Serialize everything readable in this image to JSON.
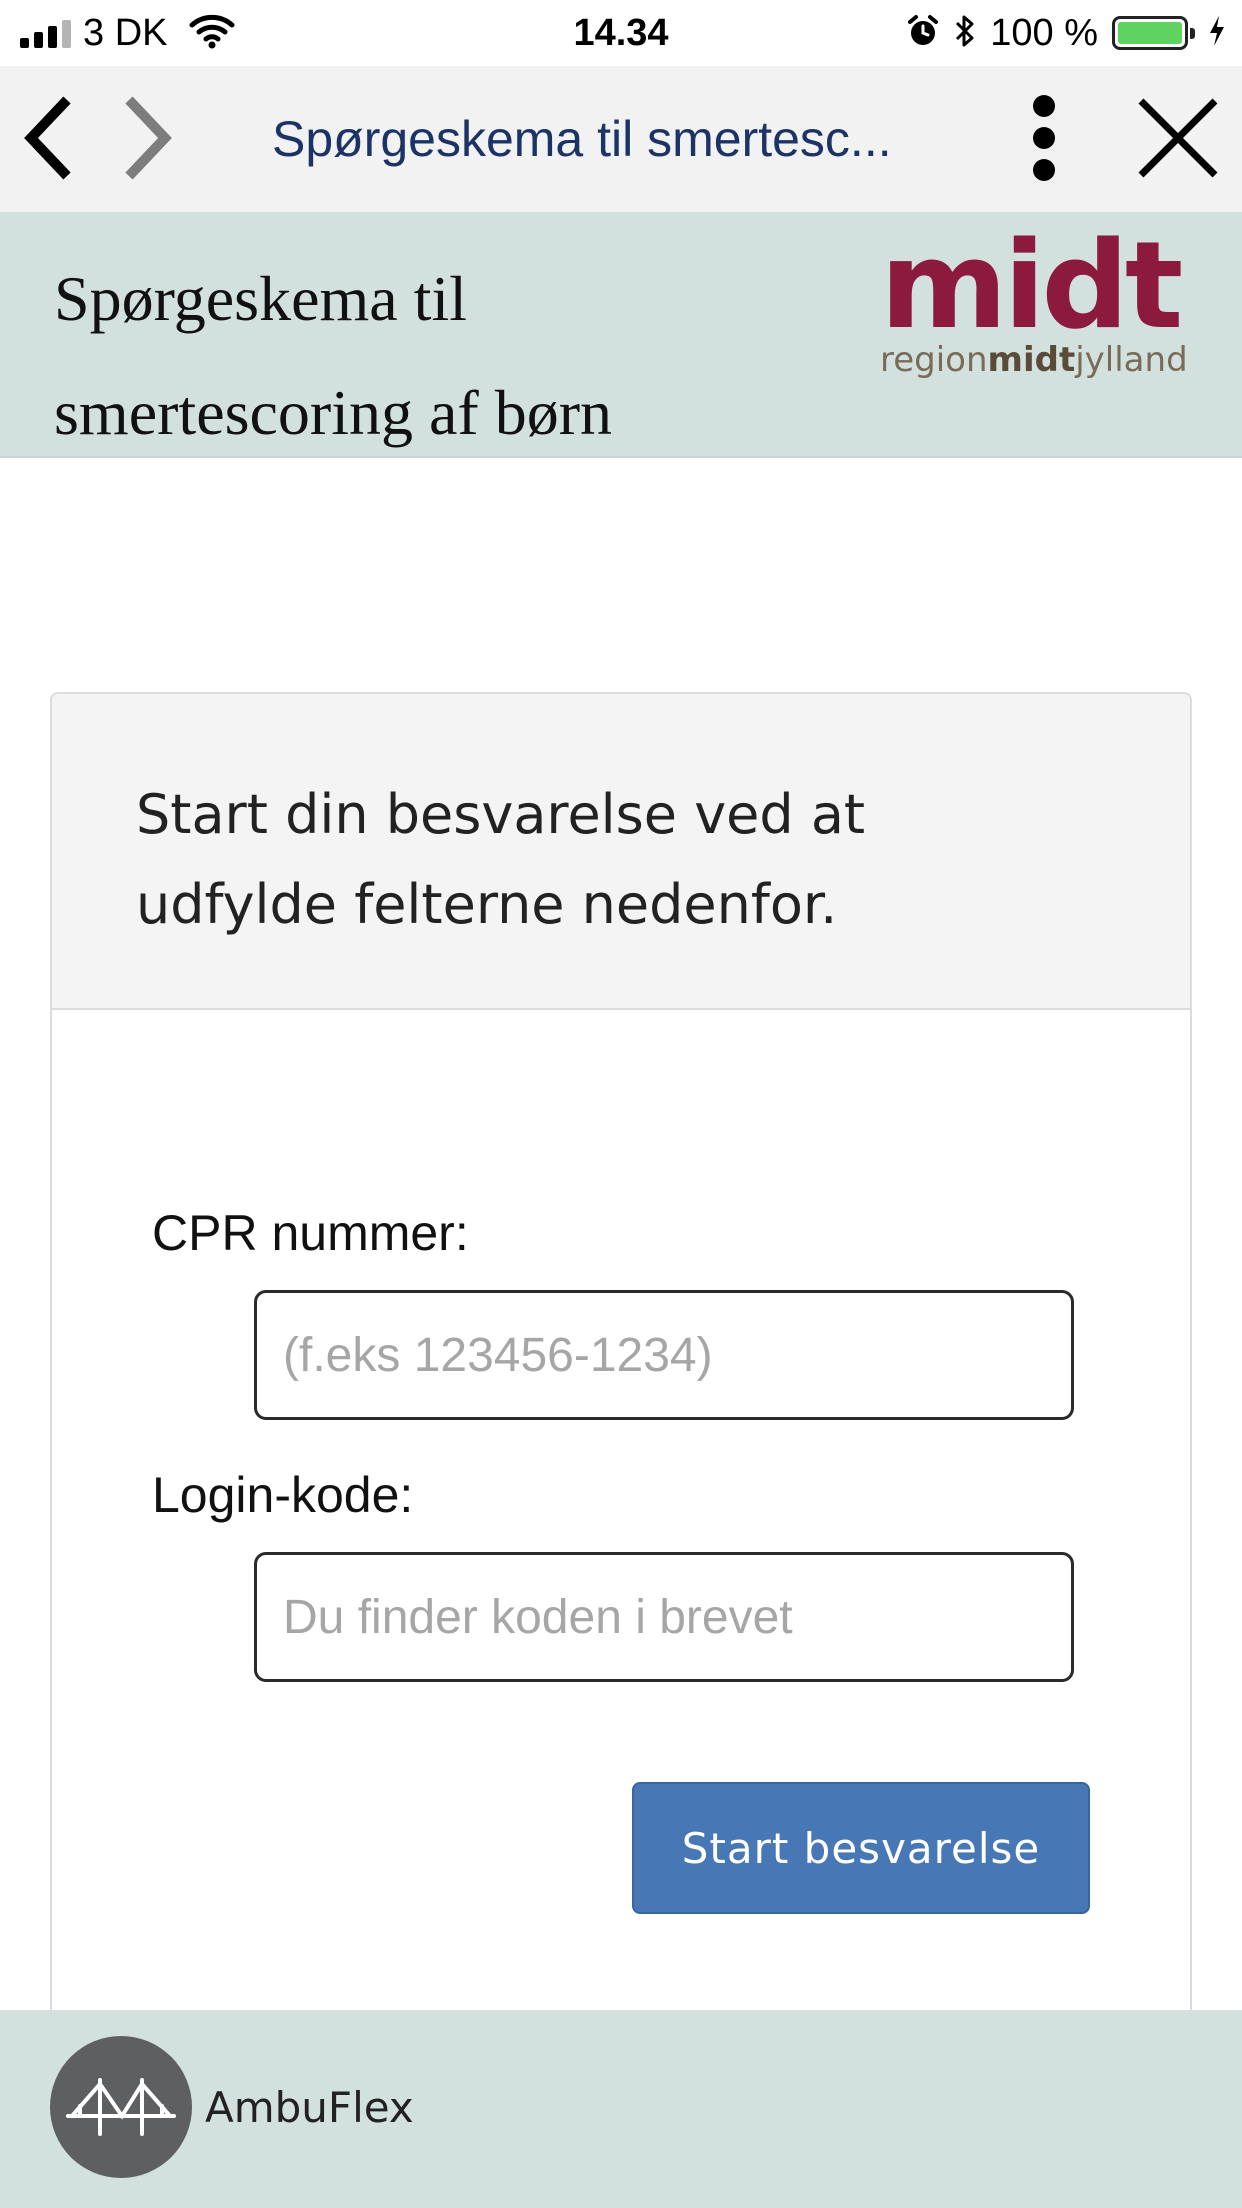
{
  "status_bar": {
    "carrier": "3 DK",
    "time": "14.34",
    "battery_percent": "100 %",
    "signal_bars": 4,
    "signal_bars_active": 3
  },
  "browser": {
    "title": "Spørgeskema til smertesc..."
  },
  "header": {
    "title": "Spørgeskema til smertescoring af børn",
    "logo_word": "midt",
    "logo_region": "region",
    "logo_midt": "midt",
    "logo_jylland": "jylland"
  },
  "card": {
    "intro": "Start din besvarelse ved at udfylde felterne nedenfor.",
    "cpr_label": "CPR nummer:",
    "cpr_placeholder": "(f.eks 123456-1234)",
    "cpr_value": "",
    "login_label": "Login-kode:",
    "login_placeholder": "Du finder koden i brevet",
    "login_value": "",
    "submit_label": "Start besvarelse"
  },
  "footer": {
    "brand": "AmbuFlex"
  },
  "colors": {
    "header_bg": "#d2e0de",
    "nav_bg": "#f2f2f2",
    "nav_title": "#1c3366",
    "logo_red": "#8c1a3f",
    "button_blue": "#4777b5",
    "battery_green": "#5fd35f"
  },
  "icons": {
    "signal": "signal-bars-icon",
    "wifi": "wifi-icon",
    "alarm": "alarm-clock-icon",
    "bluetooth": "bluetooth-icon",
    "battery": "battery-icon",
    "charging": "lightning-bolt-icon",
    "back": "chevron-left-icon",
    "forward": "chevron-right-icon",
    "menu": "vertical-dots-icon",
    "close": "close-icon",
    "footer_logo": "bridge-icon"
  }
}
